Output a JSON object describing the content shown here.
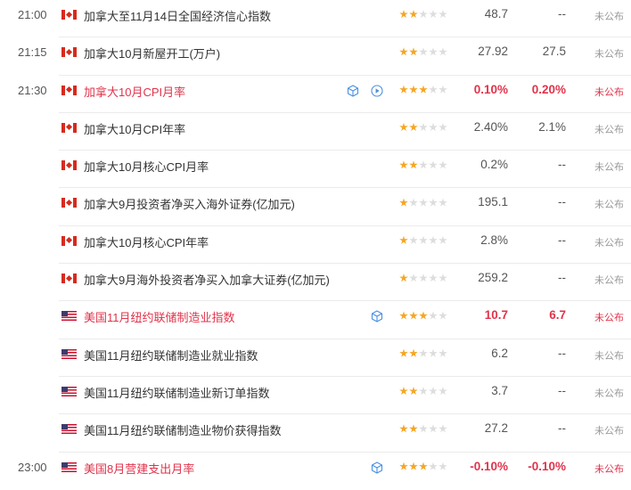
{
  "colors": {
    "important": "#e0334b",
    "star_on": "#f5a623",
    "star_off": "#dddddd",
    "icon_blue": "#4a90e2"
  },
  "rows": [
    {
      "time": "21:00",
      "flag": "ca",
      "title": "加拿大至11月14日全国经济信心指数",
      "stars": 2,
      "actual": "48.7",
      "forecast": "--",
      "status": "未公布",
      "important": false,
      "icons": []
    },
    {
      "time": "21:15",
      "flag": "ca",
      "title": "加拿大10月新屋开工(万户)",
      "stars": 2,
      "actual": "27.92",
      "forecast": "27.5",
      "status": "未公布",
      "important": false,
      "icons": []
    },
    {
      "time": "21:30",
      "flag": "ca",
      "title": "加拿大10月CPI月率",
      "stars": 3,
      "actual": "0.10%",
      "forecast": "0.20%",
      "status": "未公布",
      "important": true,
      "icons": [
        "cube-icon",
        "play-icon"
      ]
    },
    {
      "time": "",
      "flag": "ca",
      "title": "加拿大10月CPI年率",
      "stars": 2,
      "actual": "2.40%",
      "forecast": "2.1%",
      "status": "未公布",
      "important": false,
      "icons": []
    },
    {
      "time": "",
      "flag": "ca",
      "title": "加拿大10月核心CPI月率",
      "stars": 2,
      "actual": "0.2%",
      "forecast": "--",
      "status": "未公布",
      "important": false,
      "icons": []
    },
    {
      "time": "",
      "flag": "ca",
      "title": "加拿大9月投资者净买入海外证券(亿加元)",
      "stars": 1,
      "actual": "195.1",
      "forecast": "--",
      "status": "未公布",
      "important": false,
      "icons": []
    },
    {
      "time": "",
      "flag": "ca",
      "title": "加拿大10月核心CPI年率",
      "stars": 1,
      "actual": "2.8%",
      "forecast": "--",
      "status": "未公布",
      "important": false,
      "icons": []
    },
    {
      "time": "",
      "flag": "ca",
      "title": "加拿大9月海外投资者净买入加拿大证券(亿加元)",
      "stars": 1,
      "actual": "259.2",
      "forecast": "--",
      "status": "未公布",
      "important": false,
      "icons": []
    },
    {
      "time": "",
      "flag": "us",
      "title": "美国11月纽约联储制造业指数",
      "stars": 3,
      "actual": "10.7",
      "forecast": "6.7",
      "status": "未公布",
      "important": true,
      "icons": [
        "cube-icon"
      ]
    },
    {
      "time": "",
      "flag": "us",
      "title": "美国11月纽约联储制造业就业指数",
      "stars": 2,
      "actual": "6.2",
      "forecast": "--",
      "status": "未公布",
      "important": false,
      "icons": []
    },
    {
      "time": "",
      "flag": "us",
      "title": "美国11月纽约联储制造业新订单指数",
      "stars": 2,
      "actual": "3.7",
      "forecast": "--",
      "status": "未公布",
      "important": false,
      "icons": []
    },
    {
      "time": "",
      "flag": "us",
      "title": "美国11月纽约联储制造业物价获得指数",
      "stars": 2,
      "actual": "27.2",
      "forecast": "--",
      "status": "未公布",
      "important": false,
      "icons": []
    },
    {
      "time": "23:00",
      "flag": "us",
      "title": "美国8月营建支出月率",
      "stars": 3,
      "actual": "-0.10%",
      "forecast": "-0.10%",
      "status": "未公布",
      "important": true,
      "icons": [
        "cube-icon"
      ]
    }
  ]
}
